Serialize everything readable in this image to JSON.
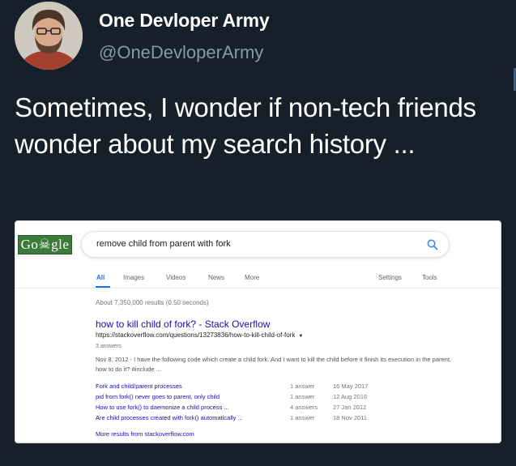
{
  "tweet": {
    "author_name": "One Devloper Army",
    "author_handle": "@OneDevloperArmy",
    "text": "Sometimes, I wonder if non-tech friends wonder about my search history ..."
  },
  "google": {
    "logo": "Go☠gle",
    "search_query": "remove child from parent with fork",
    "tabs": [
      "All",
      "Images",
      "Videos",
      "News",
      "More"
    ],
    "settings_label": "Settings",
    "tools_label": "Tools",
    "result_stats": "About 7,350,000 results (0.50 seconds)",
    "result": {
      "title": "how to kill child of fork? - Stack Overflow",
      "url": "https://stackoverflow.com/questions/13273836/how-to-kill-child-of-fork",
      "meta": "3 answers",
      "snippet": "Nov 8, 2012 - I have the following code which create a child fork. And I want to kill the child before it finish its execution in the parent. how to do it? #include ..."
    },
    "sub_results": [
      {
        "question": "Fork and child/parent processes",
        "answers": "1 answer",
        "date": "16 May 2017"
      },
      {
        "question": "pid from fork() never goes to parent, only child",
        "answers": "1 answer",
        "date": "12 Aug 2016"
      },
      {
        "question": "How to use fork() to daemonize a child process ...",
        "answers": "4 answers",
        "date": "27 Jan 2012"
      },
      {
        "question": "Are child processes created with fork() automatically ...",
        "answers": "1 answer",
        "date": "18 Nov 2011"
      }
    ],
    "more_results": "More results from stackoverflow.com"
  },
  "colors": {
    "background": "#15202b",
    "link_blue": "#1a0dab",
    "accent_blue": "#1a73e8",
    "logo_green": "#3c7b3a"
  }
}
